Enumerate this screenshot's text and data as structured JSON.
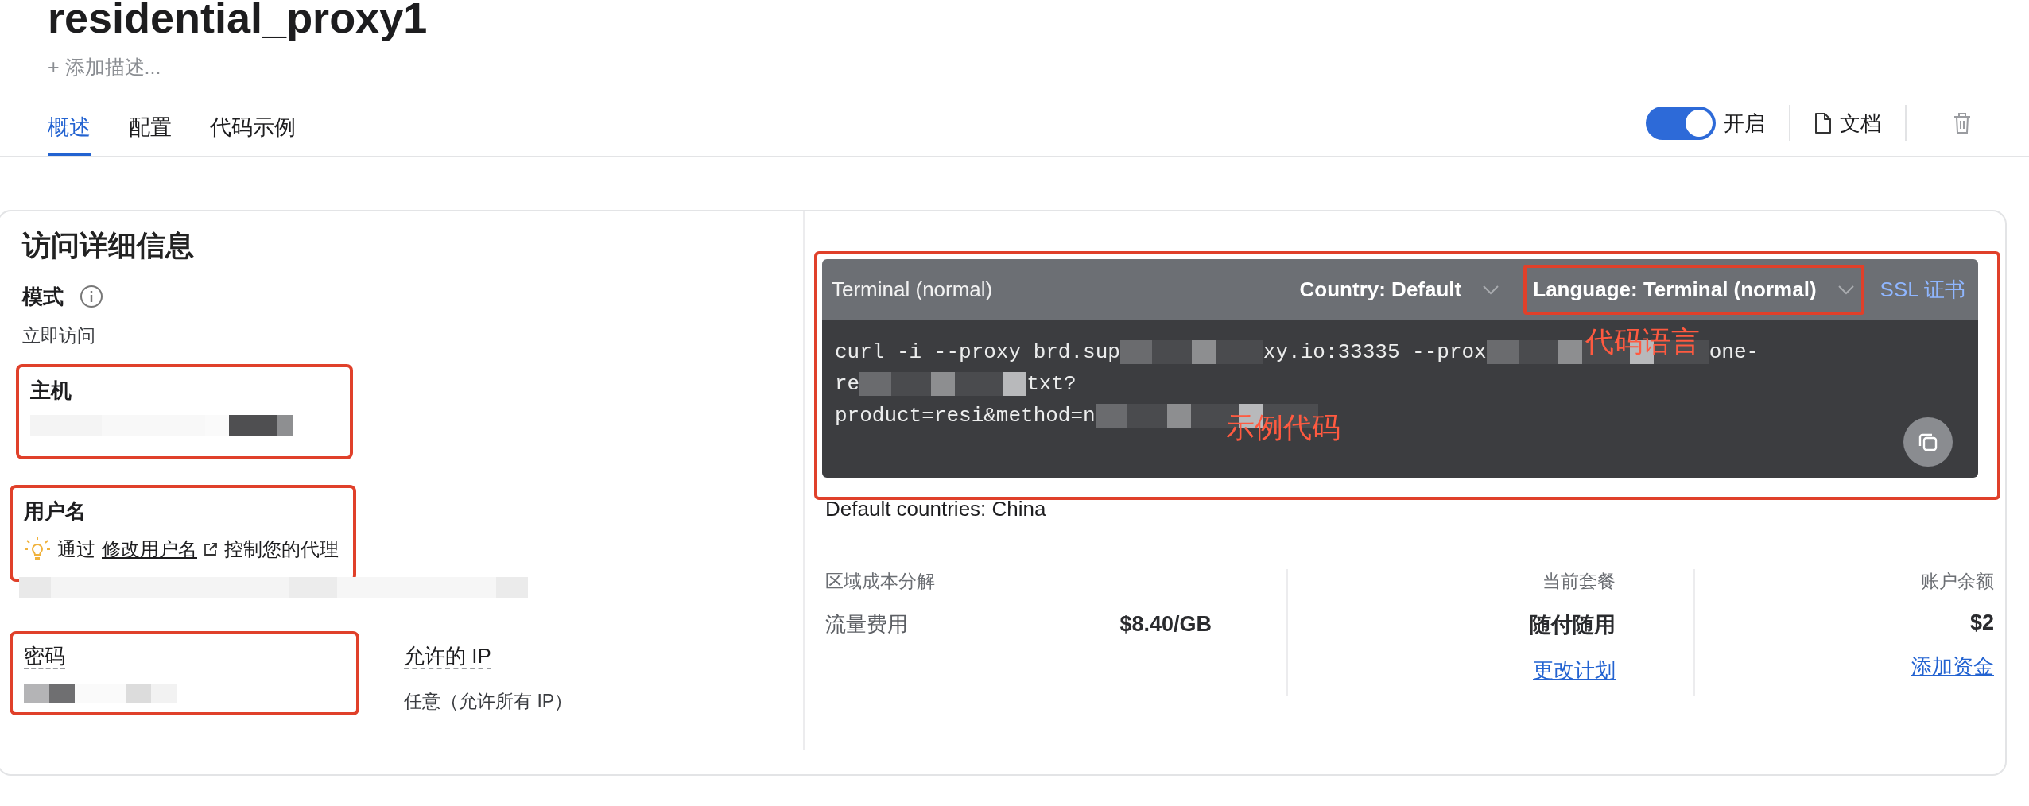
{
  "page_title": "residential_proxy1",
  "add_description": "+ 添加描述...",
  "tabs": [
    {
      "label": "概述",
      "selected": true
    },
    {
      "label": "配置",
      "selected": false
    },
    {
      "label": "代码示例",
      "selected": false
    }
  ],
  "toolbar": {
    "toggle": {
      "label": "开启",
      "on": true
    },
    "docs": "文档"
  },
  "access_details": {
    "title": "访问详细信息",
    "mode": {
      "label": "模式",
      "value": "立即访问"
    },
    "host": {
      "label": "主机",
      "redacted": true,
      "highlighted": true
    },
    "username": {
      "label": "用户名",
      "hint_before": "通过",
      "hint_link": "修改用户名",
      "hint_after": "控制您的代理",
      "redacted": true,
      "highlighted": true
    },
    "password": {
      "label": "密码",
      "redacted": true,
      "highlighted": true
    },
    "allowed_ip": {
      "label": "允许的 IP",
      "value": "任意（允许所有 IP）"
    }
  },
  "code_panel": {
    "highlighted": true,
    "title": "Terminal (normal)",
    "country": "Country: Default",
    "language": {
      "label": "Language: Terminal (normal)",
      "highlighted": true
    },
    "ssl": "SSL 证书",
    "lines": [
      [
        {
          "kind": "text",
          "text": "curl -i --proxy brd.sup"
        },
        {
          "kind": "redacted"
        },
        {
          "kind": "text",
          "text": "xy.io:33335 --prox"
        },
        {
          "kind": "redacted"
        },
        {
          "kind": "text",
          "text": "one-"
        }
      ],
      [
        {
          "kind": "text",
          "text": "re"
        },
        {
          "kind": "redacted"
        },
        {
          "kind": "text",
          "text": "txt?"
        }
      ],
      [
        {
          "kind": "text",
          "text": "product=resi&method=n"
        },
        {
          "kind": "redacted"
        }
      ]
    ],
    "annotations": {
      "language": "代码语言",
      "code": "示例代码"
    }
  },
  "default_countries": "Default countries: China",
  "stats": {
    "region": {
      "label": "区域成本分解",
      "item": "流量费用",
      "price": "$8.40/GB"
    },
    "plan": {
      "label": "当前套餐",
      "value": "随付随用",
      "link": "更改计划"
    },
    "balance": {
      "label": "账户余额",
      "value": "$2",
      "link": "添加资金"
    }
  }
}
